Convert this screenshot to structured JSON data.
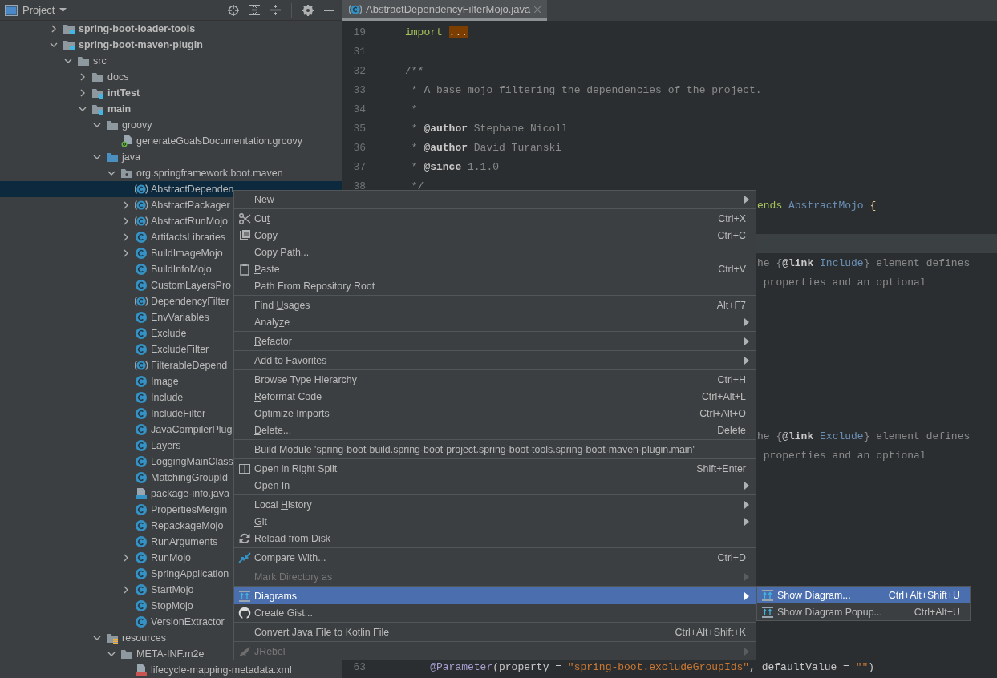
{
  "project_panel": {
    "title": "Project"
  },
  "tree": [
    {
      "label": "spring-boot-loader-tools",
      "kind": "module",
      "bold": true,
      "expanded": false,
      "selected": false
    },
    {
      "label": "spring-boot-maven-plugin",
      "kind": "module",
      "bold": true,
      "expanded": true,
      "selected": false,
      "children": [
        {
          "label": "src",
          "kind": "folder",
          "bold": false,
          "expanded": true,
          "selected": false,
          "children": [
            {
              "label": "docs",
              "kind": "folder",
              "bold": false,
              "expanded": false,
              "selected": false
            },
            {
              "label": "intTest",
              "kind": "module",
              "bold": true,
              "expanded": false,
              "selected": false
            },
            {
              "label": "main",
              "kind": "module",
              "bold": true,
              "expanded": true,
              "selected": false,
              "children": [
                {
                  "label": "groovy",
                  "kind": "folder",
                  "bold": false,
                  "expanded": true,
                  "selected": false,
                  "children": [
                    {
                      "label": "generateGoalsDocumentation.groovy",
                      "kind": "groovy",
                      "bold": false,
                      "selected": false
                    }
                  ]
                },
                {
                  "label": "java",
                  "kind": "source-folder",
                  "bold": false,
                  "expanded": true,
                  "selected": false,
                  "children": [
                    {
                      "label": "org.springframework.boot.maven",
                      "kind": "package",
                      "bold": false,
                      "expanded": true,
                      "selected": false,
                      "children": [
                        {
                          "label": "AbstractDependen",
                          "kind": "abstract-class",
                          "bold": false,
                          "selected": true
                        },
                        {
                          "label": "AbstractPackager",
                          "kind": "abstract-class",
                          "bold": false,
                          "expanded": false,
                          "selected": false
                        },
                        {
                          "label": "AbstractRunMojo",
                          "kind": "abstract-class",
                          "bold": false,
                          "expanded": false,
                          "selected": false
                        },
                        {
                          "label": "ArtifactsLibraries",
                          "kind": "class",
                          "bold": false,
                          "expanded": false,
                          "selected": false
                        },
                        {
                          "label": "BuildImageMojo",
                          "kind": "class",
                          "bold": false,
                          "expanded": false,
                          "selected": false
                        },
                        {
                          "label": "BuildInfoMojo",
                          "kind": "class",
                          "bold": false,
                          "selected": false
                        },
                        {
                          "label": "CustomLayersPro",
                          "kind": "class",
                          "bold": false,
                          "selected": false
                        },
                        {
                          "label": "DependencyFilter",
                          "kind": "abstract-class",
                          "bold": false,
                          "selected": false
                        },
                        {
                          "label": "EnvVariables",
                          "kind": "class",
                          "bold": false,
                          "selected": false
                        },
                        {
                          "label": "Exclude",
                          "kind": "class",
                          "bold": false,
                          "selected": false
                        },
                        {
                          "label": "ExcludeFilter",
                          "kind": "class",
                          "bold": false,
                          "selected": false
                        },
                        {
                          "label": "FilterableDepend",
                          "kind": "abstract-class",
                          "bold": false,
                          "selected": false
                        },
                        {
                          "label": "Image",
                          "kind": "class",
                          "bold": false,
                          "selected": false
                        },
                        {
                          "label": "Include",
                          "kind": "class",
                          "bold": false,
                          "selected": false
                        },
                        {
                          "label": "IncludeFilter",
                          "kind": "class",
                          "bold": false,
                          "selected": false
                        },
                        {
                          "label": "JavaCompilerPlug",
                          "kind": "class",
                          "bold": false,
                          "selected": false
                        },
                        {
                          "label": "Layers",
                          "kind": "class",
                          "bold": false,
                          "selected": false
                        },
                        {
                          "label": "LoggingMainClass",
                          "kind": "class",
                          "bold": false,
                          "selected": false
                        },
                        {
                          "label": "MatchingGroupId",
                          "kind": "class",
                          "bold": false,
                          "selected": false
                        },
                        {
                          "label": "package-info.java",
                          "kind": "java-file",
                          "bold": false,
                          "selected": false
                        },
                        {
                          "label": "PropertiesMergin",
                          "kind": "class",
                          "bold": false,
                          "selected": false
                        },
                        {
                          "label": "RepackageMojo",
                          "kind": "class",
                          "bold": false,
                          "selected": false
                        },
                        {
                          "label": "RunArguments",
                          "kind": "class",
                          "bold": false,
                          "selected": false
                        },
                        {
                          "label": "RunMojo",
                          "kind": "class",
                          "bold": false,
                          "expanded": false,
                          "selected": false
                        },
                        {
                          "label": "SpringApplication",
                          "kind": "class",
                          "bold": false,
                          "selected": false
                        },
                        {
                          "label": "StartMojo",
                          "kind": "class",
                          "bold": false,
                          "expanded": false,
                          "selected": false
                        },
                        {
                          "label": "StopMojo",
                          "kind": "class",
                          "bold": false,
                          "selected": false
                        },
                        {
                          "label": "VersionExtractor",
                          "kind": "class",
                          "bold": false,
                          "selected": false
                        }
                      ]
                    }
                  ]
                },
                {
                  "label": "resources",
                  "kind": "resources-folder",
                  "bold": false,
                  "expanded": true,
                  "selected": false,
                  "children": [
                    {
                      "label": "META-INF.m2e",
                      "kind": "folder",
                      "bold": false,
                      "expanded": true,
                      "selected": false,
                      "children": [
                        {
                          "label": "lifecycle-mapping-metadata.xml",
                          "kind": "xml-file",
                          "bold": false,
                          "selected": false
                        }
                      ]
                    }
                  ]
                }
              ]
            }
          ]
        }
      ]
    }
  ],
  "editor": {
    "tabs": [
      {
        "title": "AbstractDependencyFilterMojo.java",
        "selected": true
      }
    ],
    "lines": [
      {
        "kind": "full",
        "number": "19",
        "highlighted": false,
        "tokens": [
          {
            "text": "import ",
            "kind": "keyword"
          },
          {
            "text": "...",
            "kind": "fold"
          }
        ]
      },
      {
        "kind": "full",
        "number": "31",
        "highlighted": false
      },
      {
        "kind": "full",
        "number": "32",
        "highlighted": false,
        "tokens": [
          {
            "text": "/**",
            "kind": "comment"
          }
        ]
      },
      {
        "kind": "full",
        "number": "33",
        "highlighted": false,
        "tokens": [
          {
            "text": " * A base mojo filtering the dependencies of the project.",
            "kind": "comment"
          }
        ]
      },
      {
        "kind": "full",
        "number": "34",
        "highlighted": false,
        "tokens": [
          {
            "text": " *",
            "kind": "comment"
          }
        ]
      },
      {
        "kind": "full",
        "number": "35",
        "highlighted": false,
        "tokens": [
          {
            "text": " * ",
            "kind": "comment"
          },
          {
            "text": "@author",
            "kind": "tag"
          },
          {
            "text": " Stephane Nicoll",
            "kind": "comment"
          }
        ]
      },
      {
        "kind": "full",
        "number": "36",
        "highlighted": false,
        "tokens": [
          {
            "text": " * ",
            "kind": "comment"
          },
          {
            "text": "@author",
            "kind": "tag"
          },
          {
            "text": " David Turanski",
            "kind": "comment"
          }
        ]
      },
      {
        "kind": "full",
        "number": "37",
        "highlighted": false,
        "tokens": [
          {
            "text": " * ",
            "kind": "comment"
          },
          {
            "text": "@since",
            "kind": "tag"
          },
          {
            "text": " 1.1.0",
            "kind": "comment"
          }
        ]
      },
      {
        "kind": "full",
        "number": "38",
        "highlighted": false,
        "tokens": [
          {
            "text": " */",
            "kind": "comment"
          }
        ]
      },
      {
        "kind": "tail",
        "highlighted": false,
        "tokens": [
          {
            "text": "ends",
            "kind": "keyword"
          },
          {
            "text": " AbstractMojo",
            "kind": "type"
          },
          {
            "text": " {",
            "kind": "brace"
          }
        ]
      },
      {
        "kind": "tail",
        "highlighted": false
      },
      {
        "kind": "tail",
        "highlighted": true
      },
      {
        "kind": "tail",
        "highlighted": false,
        "tokens": [
          {
            "text": "he {",
            "kind": "comment"
          },
          {
            "text": "@link",
            "kind": "tag"
          },
          {
            "text": " Include",
            "kind": "type"
          },
          {
            "text": "} element defines",
            "kind": "comment"
          }
        ]
      },
      {
        "kind": "tail",
        "highlighted": false,
        "tokens": [
          {
            "text": " properties and an optional",
            "kind": "comment"
          }
        ]
      },
      {
        "kind": "tail",
        "highlighted": false
      },
      {
        "kind": "tail",
        "highlighted": false
      },
      {
        "kind": "tail",
        "highlighted": false
      },
      {
        "kind": "tail",
        "highlighted": false
      },
      {
        "kind": "tail",
        "highlighted": false
      },
      {
        "kind": "tail",
        "highlighted": false
      },
      {
        "kind": "tail",
        "highlighted": false
      },
      {
        "kind": "tail",
        "highlighted": false,
        "tokens": [
          {
            "text": "he {",
            "kind": "comment"
          },
          {
            "text": "@link",
            "kind": "tag"
          },
          {
            "text": " Exclude",
            "kind": "type"
          },
          {
            "text": "} element defines",
            "kind": "comment"
          }
        ]
      },
      {
        "kind": "tail",
        "highlighted": false,
        "tokens": [
          {
            "text": " properties and an optional",
            "kind": "comment"
          }
        ]
      },
      {
        "kind": "tail",
        "highlighted": false
      },
      {
        "kind": "tail",
        "highlighted": false
      },
      {
        "kind": "tail",
        "highlighted": false
      },
      {
        "kind": "tail",
        "highlighted": false
      },
      {
        "kind": "tail",
        "highlighted": false
      },
      {
        "kind": "tail",
        "highlighted": false
      },
      {
        "kind": "tail",
        "highlighted": false
      },
      {
        "kind": "tail",
        "highlighted": false
      },
      {
        "kind": "tail",
        "highlighted": false
      },
      {
        "kind": "tail",
        "highlighted": false
      },
      {
        "kind": "full",
        "number": "63",
        "highlighted": false,
        "tokens": [
          {
            "text": "    @Parameter",
            "kind": "annotation"
          },
          {
            "text": "(property = ",
            "kind": "plain"
          },
          {
            "text": "\"spring-boot.excludeGroupIds\"",
            "kind": "string"
          },
          {
            "text": ", defaultValue = ",
            "kind": "plain"
          },
          {
            "text": "\"\"",
            "kind": "string"
          },
          {
            "text": ")",
            "kind": "plain"
          }
        ]
      }
    ]
  },
  "context_menu": [
    {
      "items": [
        {
          "label": "New",
          "submenu": true,
          "disabled": false,
          "selected": false
        }
      ]
    },
    {
      "items": [
        {
          "label": {
            "before": "Cu",
            "key": "t"
          },
          "kind": "scissors",
          "shortcut": "Ctrl+X",
          "submenu": false,
          "disabled": false,
          "selected": false
        },
        {
          "label": {
            "key": "C",
            "after": "opy"
          },
          "kind": "copy",
          "shortcut": "Ctrl+C",
          "submenu": false,
          "disabled": false,
          "selected": false
        },
        {
          "label": "Copy Path...",
          "submenu": false,
          "disabled": false,
          "selected": false
        },
        {
          "label": {
            "key": "P",
            "after": "aste"
          },
          "kind": "paste",
          "shortcut": "Ctrl+V",
          "submenu": false,
          "disabled": false,
          "selected": false
        },
        {
          "label": "Path From Repository Root",
          "submenu": false,
          "disabled": false,
          "selected": false
        }
      ]
    },
    {
      "items": [
        {
          "label": {
            "before": "Find ",
            "key": "U",
            "after": "sages"
          },
          "shortcut": "Alt+F7",
          "submenu": false,
          "disabled": false,
          "selected": false
        },
        {
          "label": {
            "before": "Analy",
            "key": "z",
            "after": "e"
          },
          "submenu": true,
          "disabled": false,
          "selected": false
        }
      ]
    },
    {
      "items": [
        {
          "label": {
            "key": "R",
            "after": "efactor"
          },
          "submenu": true,
          "disabled": false,
          "selected": false
        }
      ]
    },
    {
      "items": [
        {
          "label": {
            "before": "Add to F",
            "key": "a",
            "after": "vorites"
          },
          "submenu": true,
          "disabled": false,
          "selected": false
        }
      ]
    },
    {
      "items": [
        {
          "label": "Browse Type Hierarchy",
          "shortcut": "Ctrl+H",
          "submenu": false,
          "disabled": false,
          "selected": false
        },
        {
          "label": {
            "key": "R",
            "after": "eformat Code"
          },
          "shortcut": "Ctrl+Alt+L",
          "submenu": false,
          "disabled": false,
          "selected": false
        },
        {
          "label": {
            "before": "Optimi",
            "key": "z",
            "after": "e Imports"
          },
          "shortcut": "Ctrl+Alt+O",
          "submenu": false,
          "disabled": false,
          "selected": false
        },
        {
          "label": {
            "key": "D",
            "after": "elete..."
          },
          "shortcut": "Delete",
          "submenu": false,
          "disabled": false,
          "selected": false
        }
      ]
    },
    {
      "items": [
        {
          "label": {
            "before": "Build ",
            "key": "M",
            "after": "odule 'spring-boot-build.spring-boot-project.spring-boot-tools.spring-boot-maven-plugin.main'"
          },
          "submenu": false,
          "disabled": false,
          "selected": false
        }
      ]
    },
    {
      "items": [
        {
          "label": "Open in Right Split",
          "kind": "split",
          "shortcut": "Shift+Enter",
          "submenu": false,
          "disabled": false,
          "selected": false
        },
        {
          "label": "Open In",
          "submenu": true,
          "disabled": false,
          "selected": false
        }
      ]
    },
    {
      "items": [
        {
          "label": {
            "before": "Local ",
            "key": "H",
            "after": "istory"
          },
          "submenu": true,
          "disabled": false,
          "selected": false
        },
        {
          "label": {
            "key": "G",
            "after": "it"
          },
          "submenu": true,
          "disabled": false,
          "selected": false
        },
        {
          "label": "Reload from Disk",
          "kind": "reload",
          "submenu": false,
          "disabled": false,
          "selected": false
        }
      ]
    },
    {
      "items": [
        {
          "label": "Compare With...",
          "kind": "compare",
          "shortcut": "Ctrl+D",
          "submenu": false,
          "disabled": false,
          "selected": false
        }
      ]
    },
    {
      "items": [
        {
          "label": "Mark Directory as",
          "submenu": true,
          "disabled": true,
          "selected": false
        }
      ]
    },
    {
      "items": [
        {
          "label": "Diagrams",
          "kind": "diagram",
          "submenu": true,
          "disabled": false,
          "selected": true
        },
        {
          "label": "Create Gist...",
          "kind": "cat",
          "submenu": false,
          "disabled": false,
          "selected": false
        }
      ]
    },
    {
      "items": [
        {
          "label": "Convert Java File to Kotlin File",
          "shortcut": "Ctrl+Alt+Shift+K",
          "submenu": false,
          "disabled": false,
          "selected": false
        }
      ]
    },
    {
      "items": [
        {
          "label": "JRebel",
          "kind": "bird",
          "submenu": true,
          "disabled": true,
          "selected": false
        }
      ]
    }
  ],
  "diagrams_submenu": [
    {
      "label": "Show Diagram...",
      "kind": "diagram",
      "shortcut": "Ctrl+Alt+Shift+U",
      "selected": true
    },
    {
      "label": "Show Diagram Popup...",
      "kind": "diagram",
      "shortcut": "Ctrl+Alt+U",
      "selected": false
    }
  ]
}
